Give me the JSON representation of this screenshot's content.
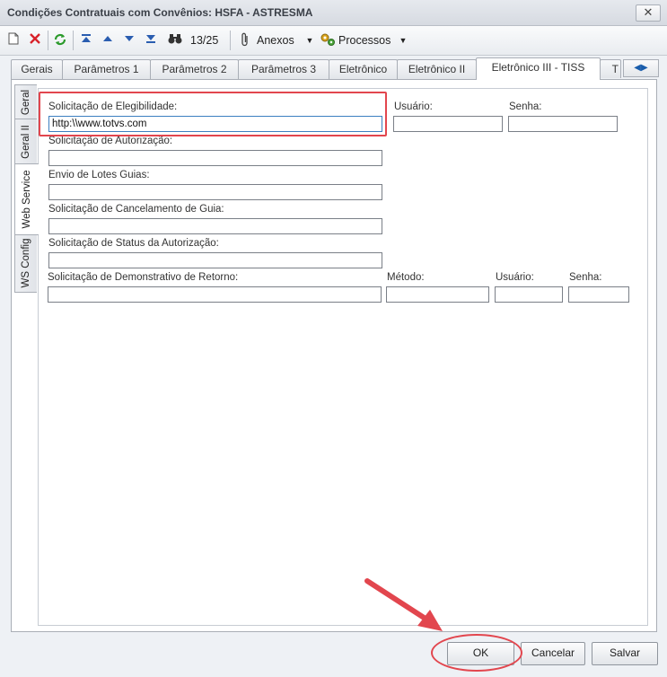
{
  "window": {
    "title": "Condições Contratuais com Convênios: HSFA - ASTRESMA",
    "close_glyph": "✕"
  },
  "toolbar": {
    "new_icon": "document-icon",
    "delete_icon": "delete-x-icon",
    "refresh_icon": "refresh-icon",
    "record_position": "13/25",
    "attachments_label": "Anexos",
    "processes_label": "Processos"
  },
  "tabs": [
    {
      "label": "Gerais",
      "active": false
    },
    {
      "label": "Parâmetros 1",
      "active": false
    },
    {
      "label": "Parâmetros 2",
      "active": false
    },
    {
      "label": "Parâmetros 3",
      "active": false
    },
    {
      "label": "Eletrônico",
      "active": false
    },
    {
      "label": "Eletrônico II",
      "active": false
    },
    {
      "label": "Eletrônico III - TISS",
      "active": true
    },
    {
      "label": "T",
      "active": false
    }
  ],
  "side_tabs": [
    {
      "label": "Geral",
      "active": false
    },
    {
      "label": "Geral II",
      "active": false
    },
    {
      "label": "Web Service",
      "active": true
    },
    {
      "label": "WS Config",
      "active": false
    }
  ],
  "form": {
    "elegibilidade": {
      "label": "Solicitação de Elegibilidade:",
      "value": "http:\\\\www.totvs.com"
    },
    "usuario_label": "Usuário:",
    "senha_label": "Senha:",
    "usuario_value": "",
    "senha_value": "",
    "autorizacao": {
      "label": "Solicitação de Autorização:",
      "value": ""
    },
    "lotes": {
      "label": "Envio de Lotes Guias:",
      "value": ""
    },
    "cancelamento": {
      "label": "Solicitação de Cancelamento de Guia:",
      "value": ""
    },
    "status": {
      "label": "Solicitação de Status da Autorização:",
      "value": ""
    },
    "demonstrativo": {
      "label": "Solicitação de Demonstrativo de Retorno:",
      "value": ""
    },
    "metodo_label": "Método:",
    "usuario2_label": "Usuário:",
    "senha2_label": "Senha:"
  },
  "buttons": {
    "ok": "OK",
    "cancel": "Cancelar",
    "save": "Salvar"
  },
  "annotation_color": "#e2464e"
}
